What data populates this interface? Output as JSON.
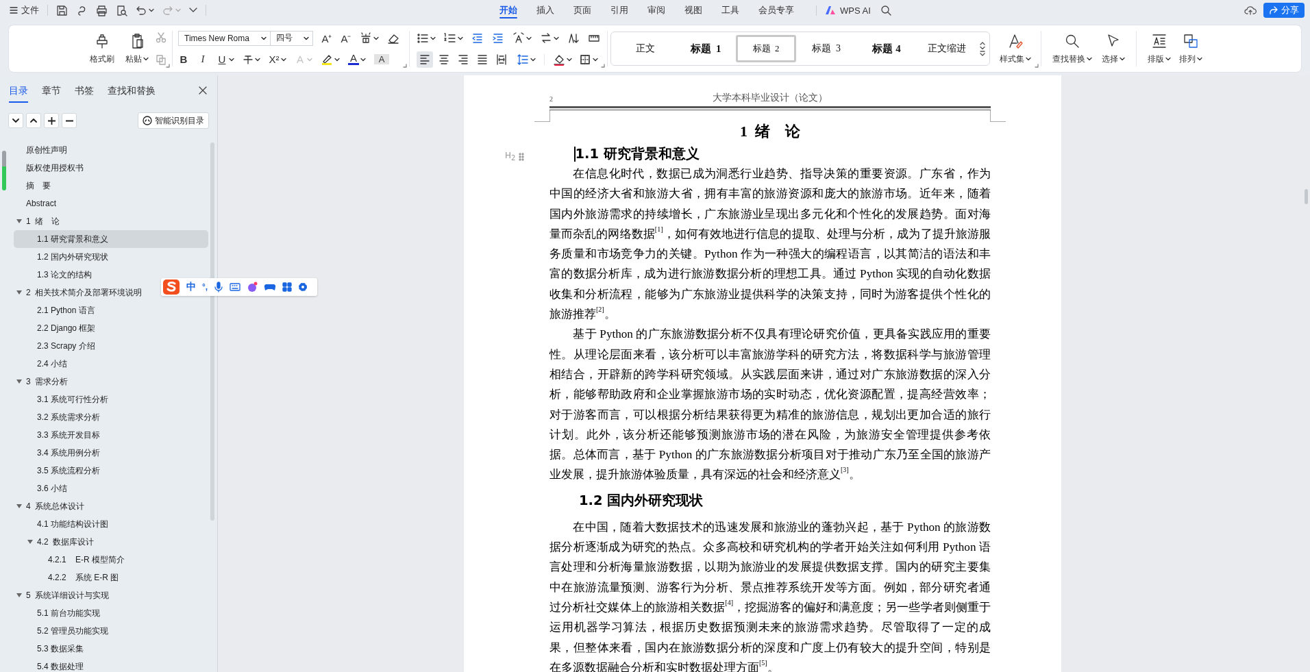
{
  "top_bar": {
    "file_menu": "文件",
    "tabs": [
      {
        "label": "开始",
        "selected": true
      },
      {
        "label": "插入",
        "selected": false
      },
      {
        "label": "页面",
        "selected": false
      },
      {
        "label": "引用",
        "selected": false
      },
      {
        "label": "审阅",
        "selected": false
      },
      {
        "label": "视图",
        "selected": false
      },
      {
        "label": "工具",
        "selected": false
      },
      {
        "label": "会员专享",
        "selected": false
      }
    ],
    "ai_button": "WPS AI",
    "share_button": "分享"
  },
  "ribbon": {
    "format_painter": "格式刷",
    "paste": "粘贴",
    "font_name": "Times New Roma",
    "font_size": "四号",
    "grow_font": "A⁺",
    "shrink_font": "A⁻",
    "bold": "B",
    "italic": "I",
    "underline": "U",
    "superscript": "X²",
    "text_effect": "A",
    "font_color": "A",
    "shading": "A",
    "alignment": [
      {
        "kind": "left",
        "selected": true
      },
      {
        "kind": "center",
        "selected": false
      },
      {
        "kind": "right",
        "selected": false
      },
      {
        "kind": "justify",
        "selected": false
      },
      {
        "kind": "distributed",
        "selected": false
      }
    ],
    "styles": [
      {
        "label": "正文",
        "bold": false,
        "selected": false
      },
      {
        "label": "标题  1",
        "bold": true,
        "selected": false
      },
      {
        "label": "标题  2",
        "bold": false,
        "selected": true
      },
      {
        "label": "标题  3",
        "bold": false,
        "selected": false
      },
      {
        "label": "标题 4",
        "bold": true,
        "selected": false
      },
      {
        "label": "正文缩进",
        "bold": false,
        "selected": false
      }
    ],
    "style_set": "样式集",
    "find_replace": "查找替换",
    "select": "选择",
    "layout": "排版",
    "arrange": "排列"
  },
  "sidebar": {
    "tabs": [
      {
        "label": "目录",
        "selected": true
      },
      {
        "label": "章节",
        "selected": false
      },
      {
        "label": "书签",
        "selected": false
      },
      {
        "label": "查找和替换",
        "selected": false
      }
    ],
    "smart_toc": "智能识别目录",
    "toc": [
      {
        "label": "原创性声明",
        "selected": false
      },
      {
        "label": "版权使用授权书",
        "selected": false
      },
      {
        "label": "摘　要",
        "selected": false
      },
      {
        "label": "Abstract",
        "selected": false
      },
      {
        "label": "1  绪　论",
        "selected": false,
        "expanded": true,
        "children": [
          {
            "label": "1.1 研究背景和意义",
            "selected": true
          },
          {
            "label": "1.2 国内外研究现状",
            "selected": false
          },
          {
            "label": "1.3 论文的结构",
            "selected": false
          }
        ]
      },
      {
        "label": "2  相关技术简介及部署环境说明",
        "selected": false,
        "expanded": true,
        "children": [
          {
            "label": "2.1 Python 语言",
            "selected": false
          },
          {
            "label": "2.2 Django 框架",
            "selected": false
          },
          {
            "label": "2.3 Scrapy 介绍",
            "selected": false
          },
          {
            "label": "2.4 小结",
            "selected": false
          }
        ]
      },
      {
        "label": "3  需求分析",
        "selected": false,
        "expanded": true,
        "children": [
          {
            "label": "3.1 系统可行性分析",
            "selected": false
          },
          {
            "label": "3.2 系统需求分析",
            "selected": false
          },
          {
            "label": "3.3 系统开发目标",
            "selected": false
          },
          {
            "label": "3.4 系统用例分析",
            "selected": false
          },
          {
            "label": "3.5 系统流程分析",
            "selected": false
          },
          {
            "label": "3.6 小结",
            "selected": false
          }
        ]
      },
      {
        "label": "4  系统总体设计",
        "selected": false,
        "expanded": true,
        "children": [
          {
            "label": "4.1 功能结构设计图",
            "selected": false
          },
          {
            "label": "4.2  数据库设计",
            "selected": false,
            "expanded": true,
            "children": [
              {
                "label": "4.2.1    E-R 模型简介",
                "selected": false
              },
              {
                "label": "4.2.2    系统 E-R 图",
                "selected": false
              }
            ]
          }
        ]
      },
      {
        "label": "5  系统详细设计与实现",
        "selected": false,
        "expanded": true,
        "children": [
          {
            "label": "5.1 前台功能实现",
            "selected": false
          },
          {
            "label": "5.2 管理员功能实现",
            "selected": false
          },
          {
            "label": "5.3 数据采集",
            "selected": false
          },
          {
            "label": "5.4 数据处理",
            "selected": false
          }
        ]
      }
    ]
  },
  "ime_bar": {
    "mode": "中",
    "punctuation": "°,"
  },
  "document": {
    "page_number": "2",
    "header": "大学本科毕业设计（论文）",
    "chapter_title": "1  绪　论",
    "heading_marker": "H$_{2}$",
    "sections": [
      {
        "heading": "1.1 研究背景和意义",
        "paragraphs": [
          "在信息化时代，数据已成为洞悉行业趋势、指导决策的重要资源。广东省，作为中国的经济大省和旅游大省，拥有丰富的旅游资源和庞大的旅游市场。近年来，随着国内外旅游需求的持续增长，广东旅游业呈现出多元化和个性化的发展趋势。面对海量而杂乱的网络数据$^{[1]}$，如何有效地进行信息的提取、处理与分析，成为了提升旅游服务质量和市场竞争力的关键。Python 作为一种强大的编程语言，以其简洁的语法和丰富的数据分析库，成为进行旅游数据分析的理想工具。通过 Python 实现的自动化数据收集和分析流程，能够为广东旅游业提供科学的决策支持，同时为游客提供个性化的旅游推荐$^{[2]}$。",
          "基于 Python 的广东旅游数据分析不仅具有理论研究价值，更具备实践应用的重要性。从理论层面来看，该分析可以丰富旅游学科的研究方法，将数据科学与旅游管理相结合，开辟新的跨学科研究领域。从实践层面来讲，通过对广东旅游数据的深入分析，能够帮助政府和企业掌握旅游市场的实时动态，优化资源配置，提高经营效率；对于游客而言，可以根据分析结果获得更为精准的旅游信息，规划出更加合适的旅行计划。此外，该分析还能够预测旅游市场的潜在风险，为旅游安全管理提供参考依据。总体而言，基于 Python 的广东旅游数据分析项目对于推动广东乃至全国的旅游产业发展，提升旅游体验质量，具有深远的社会和经济意义$^{[3]}$。"
        ]
      },
      {
        "heading": "1.2 国内外研究现状",
        "paragraphs": [
          "在中国，随着大数据技术的迅速发展和旅游业的蓬勃兴起，基于 Python 的旅游数据分析逐渐成为研究的热点。众多高校和研究机构的学者开始关注如何利用 Python 语言处理和分析海量旅游数据，以期为旅游业的发展提供数据支撑。国内的研究主要集中在旅游流量预测、游客行为分析、景点推荐系统开发等方面。例如，部分研究者通过分析社交媒体上的旅游相关数据$^{[4]}$，挖掘游客的偏好和满意度；另一些学者则侧重于运用机器学习算法，根据历史数据预测未来的旅游需求趋势。尽管取得了一定的成果，但整体来看，国内在旅游数据分析的深度和广度上仍有较大的提升空间，特别是在多源数据融合分析和实时数据处理方面$^{[5]}$。"
        ]
      }
    ]
  }
}
